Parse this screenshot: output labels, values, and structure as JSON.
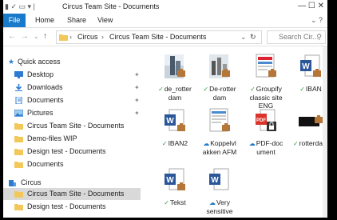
{
  "window": {
    "title": "Circus Team Site - Documents",
    "controls": "—   ☐   ✕"
  },
  "ribbon": {
    "tabs": [
      "File",
      "Home",
      "Share",
      "View"
    ]
  },
  "address": {
    "crumbs": [
      "Circus",
      "Circus Team Site - Documents"
    ],
    "search_placeholder": "Search Cir..."
  },
  "sidebar": {
    "quick_access": "Quick access",
    "items": [
      {
        "label": "Desktop",
        "icon": "desktop-icon",
        "pinned": true
      },
      {
        "label": "Downloads",
        "icon": "downloads-icon",
        "pinned": true
      },
      {
        "label": "Documents",
        "icon": "documents-icon",
        "pinned": true
      },
      {
        "label": "Pictures",
        "icon": "pictures-icon",
        "pinned": true
      },
      {
        "label": "Circus Team Site - Documents",
        "icon": "folder-icon"
      },
      {
        "label": "Demo-files WIP",
        "icon": "folder-icon"
      },
      {
        "label": "Design test - Documents",
        "icon": "folder-icon"
      },
      {
        "label": "Documents",
        "icon": "folder-icon"
      }
    ],
    "circus": "Circus",
    "circus_items": [
      {
        "label": "Circus Team Site - Documents",
        "icon": "folder-icon"
      },
      {
        "label": "Design test - Documents",
        "icon": "folder-icon"
      }
    ]
  },
  "files": [
    {
      "name": "de_rotter dam",
      "type": "photo",
      "status": "synced"
    },
    {
      "name": "De-rotter dam",
      "type": "photo",
      "status": "synced"
    },
    {
      "name": "Groupify classic site ENG",
      "type": "webpage",
      "status": "synced"
    },
    {
      "name": "IBAN",
      "type": "word",
      "status": "synced"
    },
    {
      "name": "IBAN2",
      "type": "word",
      "status": "synced"
    },
    {
      "name": "Koppelvl akken AFM",
      "type": "webpage",
      "status": "cloud"
    },
    {
      "name": "PDF-doc ument",
      "type": "pdf",
      "status": "cloud"
    },
    {
      "name": "rotterdam",
      "type": "black",
      "status": "synced"
    },
    {
      "name": "Tekst",
      "type": "word",
      "status": "synced"
    },
    {
      "name": "Very sensitive",
      "type": "word",
      "status": "cloud"
    }
  ],
  "colors": {
    "accent": "#1979ca",
    "folder": "#f3c85b",
    "synced": "#2f9e44",
    "cloud": "#1979ca",
    "badge": "#b5763a",
    "word": "#2b579a",
    "pdf": "#d9342b"
  }
}
